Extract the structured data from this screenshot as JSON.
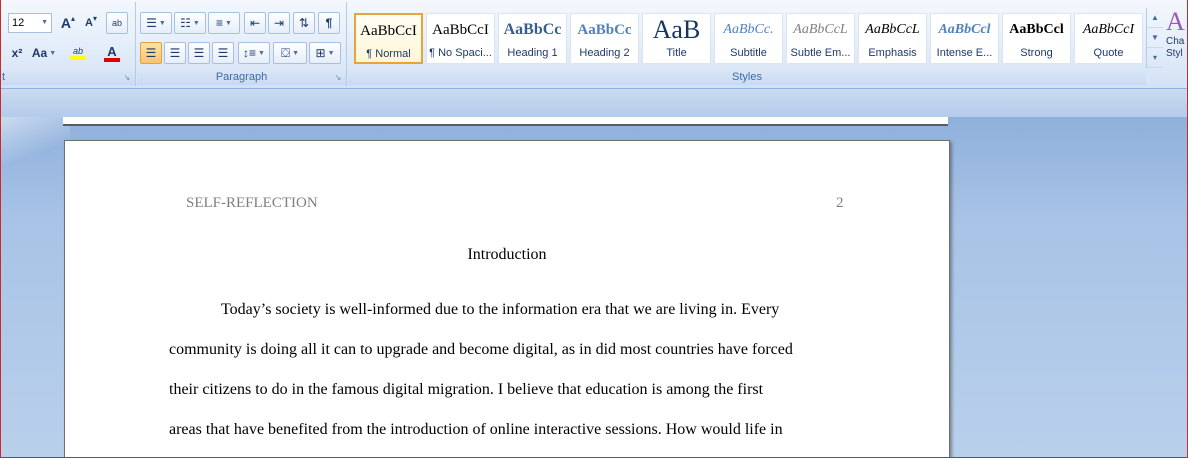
{
  "font_group": {
    "label": "t",
    "font_size": "12",
    "grow_font_glyph": "A",
    "shrink_font_glyph": "A",
    "clear_format_glyph": "ab",
    "superscript_glyph": "x²",
    "change_case_label": "Aa",
    "highlight_glyph": "ab",
    "font_color_glyph": "A"
  },
  "paragraph_group": {
    "label": "Paragraph",
    "pilcrow_glyph": "¶"
  },
  "styles_group": {
    "label": "Styles",
    "items": [
      {
        "sample": "AaBbCcI",
        "name": "¶ Normal"
      },
      {
        "sample": "AaBbCcI",
        "name": "¶ No Spaci..."
      },
      {
        "sample": "AaBbCc",
        "name": "Heading 1"
      },
      {
        "sample": "AaBbCc",
        "name": "Heading 2"
      },
      {
        "sample": "AaB",
        "name": "Title"
      },
      {
        "sample": "AaBbCc.",
        "name": "Subtitle"
      },
      {
        "sample": "AaBbCcL",
        "name": "Subtle Em..."
      },
      {
        "sample": "AaBbCcL",
        "name": "Emphasis"
      },
      {
        "sample": "AaBbCcl",
        "name": "Intense E..."
      },
      {
        "sample": "AaBbCcl",
        "name": "Strong"
      },
      {
        "sample": "AaBbCcI",
        "name": "Quote"
      }
    ],
    "change_styles_glyph": "A",
    "change_styles_label_1": "Cha",
    "change_styles_label_2": "Styl"
  },
  "document": {
    "header_left": "SELF-REFLECTION",
    "header_right": "2",
    "title": "Introduction",
    "lines": [
      "Today’s society is well-informed due to the information era that we are living in. Every",
      "community is doing all it can to upgrade and become digital, as in did most countries have forced",
      "their citizens to do in the famous digital migration. I believe that education is among the first",
      "areas that have benefited from the introduction of online interactive sessions. How would life in"
    ]
  },
  "colors": {
    "ribbon_text": "#15428b",
    "selected_style_border": "#e7a43c",
    "highlight_color": "#ffff00",
    "font_color": "#e00000",
    "heading_blue": "#4f81bd",
    "title_color": "#17365d"
  }
}
